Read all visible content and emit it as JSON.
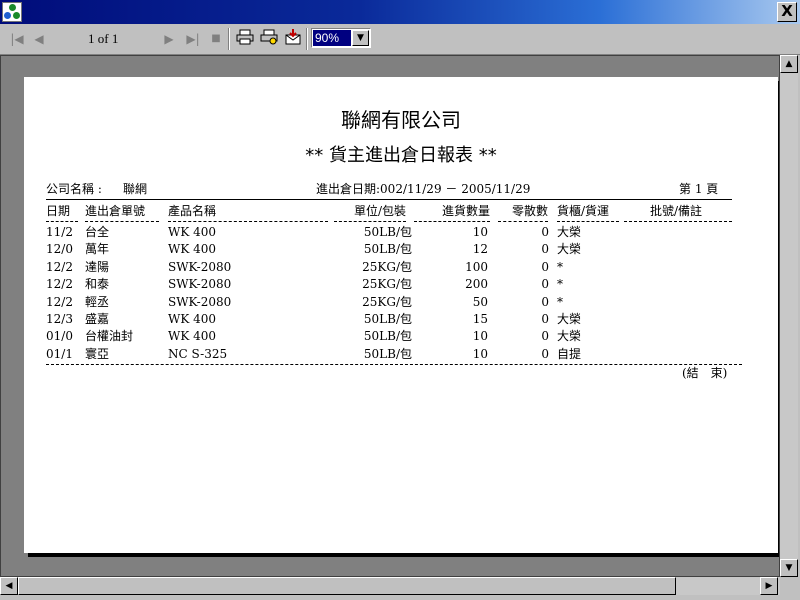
{
  "window": {
    "close_label": "X"
  },
  "toolbar": {
    "page_indicator": "1 of 1",
    "zoom": "90%"
  },
  "report": {
    "company": "聯網有限公司",
    "title": "** 貨主進出倉日報表 **",
    "company_label": "公司名稱 :",
    "company_value": "聯網",
    "date_range": "進出倉日期:002/11/29 － 2005/11/29",
    "page": "第 1 頁",
    "columns": [
      "日期",
      "進出倉單號",
      "產品名稱",
      "單位/包裝",
      "進貨數量",
      "零散數",
      "貨櫃/貨運",
      "批號/備註"
    ],
    "rows": [
      [
        "11/2",
        "台全",
        "WK 400",
        "50LB/包",
        "10",
        "0",
        "大榮",
        ""
      ],
      [
        "12/0",
        "萬年",
        "WK 400",
        "50LB/包",
        "12",
        "0",
        "大榮",
        ""
      ],
      [
        "12/2",
        "達陽",
        "SWK-2080",
        "25KG/包",
        "100",
        "0",
        "*",
        ""
      ],
      [
        "12/2",
        "和泰",
        "SWK-2080",
        "25KG/包",
        "200",
        "0",
        "*",
        ""
      ],
      [
        "12/2",
        "輕丞",
        "SWK-2080",
        "25KG/包",
        "50",
        "0",
        "*",
        ""
      ],
      [
        "12/3",
        "盛嘉",
        "WK 400",
        "50LB/包",
        "15",
        "0",
        "大榮",
        ""
      ],
      [
        "01/0",
        "台權油封",
        "WK 400",
        "50LB/包",
        "10",
        "0",
        "大榮",
        ""
      ],
      [
        "01/1",
        "寰亞",
        "NC S-325",
        "50LB/包",
        "10",
        "0",
        "自提",
        ""
      ]
    ],
    "end_mark": "(結　束)"
  }
}
